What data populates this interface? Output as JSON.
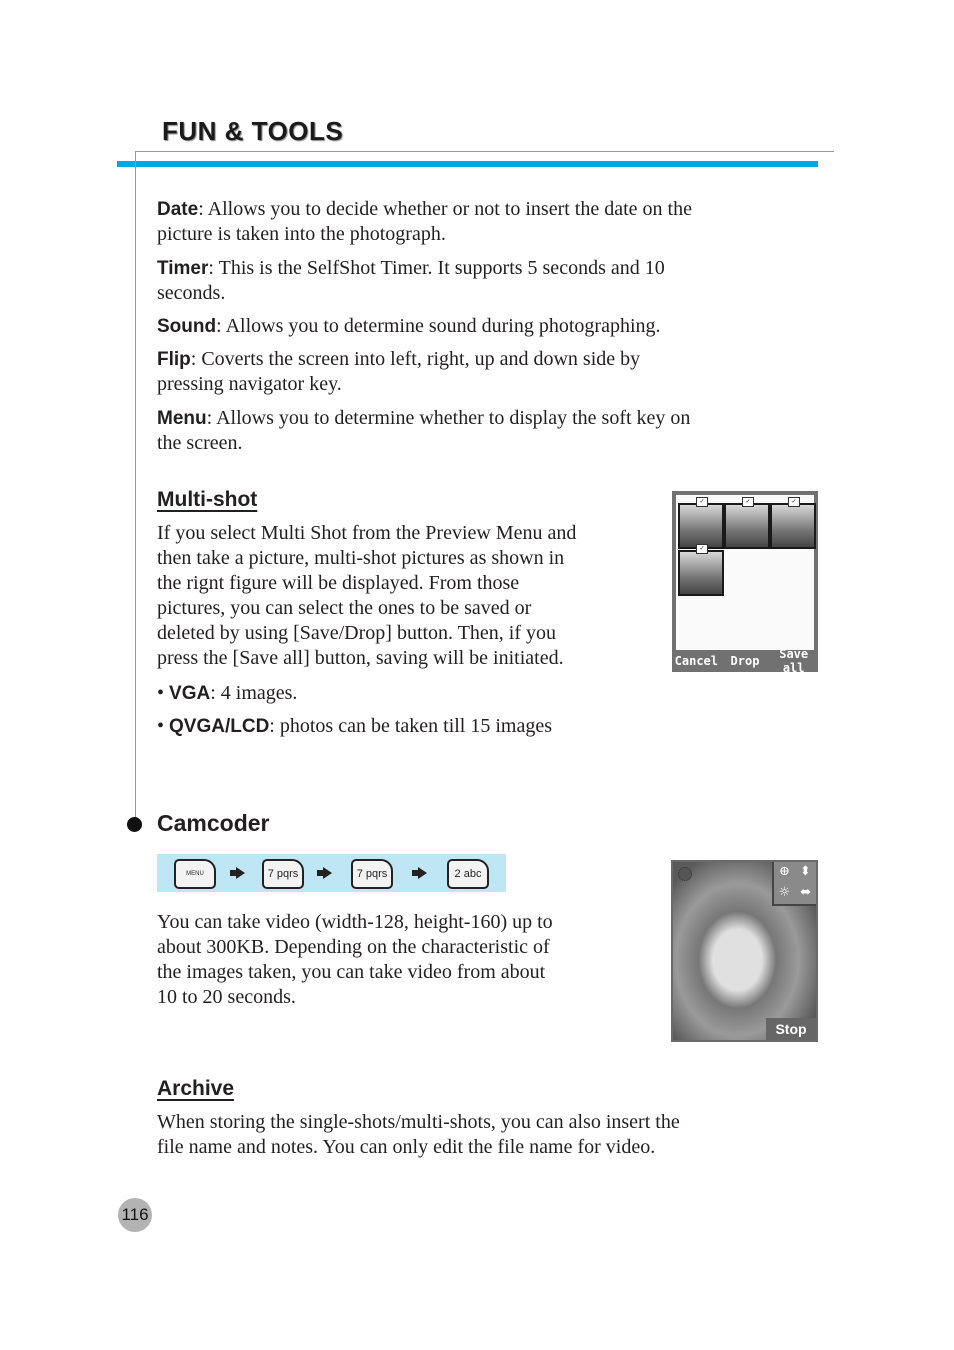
{
  "header": {
    "title": "FUN & TOOLS",
    "accent_color": "#00a8e6"
  },
  "camera_options": [
    {
      "term": "Date",
      "desc": ": Allows you to decide whether or not to insert the date on the",
      "desc2": "picture is taken into the photograph."
    },
    {
      "term": "Timer",
      "desc": ": This is the SelfShot Timer. It supports 5 seconds and 10",
      "desc2": "seconds."
    },
    {
      "term": "Sound",
      "desc": ": Allows you to determine sound during photographing.",
      "desc2": ""
    },
    {
      "term": "Flip",
      "desc": ": Coverts the screen into left, right, up and down side by",
      "desc2": "pressing navigator key."
    },
    {
      "term": "Menu",
      "desc": ": Allows you to determine whether to display the soft key on",
      "desc2": "the screen."
    }
  ],
  "multishot": {
    "heading": "Multi-shot",
    "lines": [
      "If you select Multi Shot from the Preview Menu and",
      "then take a picture, multi-shot pictures as shown in",
      "the rignt figure will be displayed. From those",
      "pictures, you can select the ones to be saved or",
      "deleted by using [Save/Drop] button. Then, if you",
      "press the [Save all] button, saving will be initiated."
    ],
    "bullets": [
      {
        "term": "VGA",
        "desc": ": 4 images."
      },
      {
        "term": "QVGA/LCD",
        "desc": ": photos can be taken till 15 images"
      }
    ],
    "screen": {
      "softkeys": [
        "Cancel",
        "Drop",
        "Save all"
      ],
      "thumb_tag": "✓"
    }
  },
  "camcoder": {
    "heading": "Camcoder",
    "keys": [
      "MENU",
      "7 pqrs",
      "7 pqrs",
      "2 abc"
    ],
    "lines": [
      "You can take video (width-128, height-160) up to",
      "about 300KB. Depending on the characteristic of",
      "the images taken, you can take video from about",
      "10 to 20 seconds."
    ],
    "screen": {
      "stop_label": "Stop",
      "icons": [
        "zoom-icon",
        "up-down-icon",
        "brightness-icon",
        "left-right-icon"
      ]
    }
  },
  "archive": {
    "heading": "Archive",
    "lines": [
      "When storing the single-shots/multi-shots, you can also insert the",
      "file name and notes. You can only edit the file name for video."
    ]
  },
  "page_number": "116"
}
